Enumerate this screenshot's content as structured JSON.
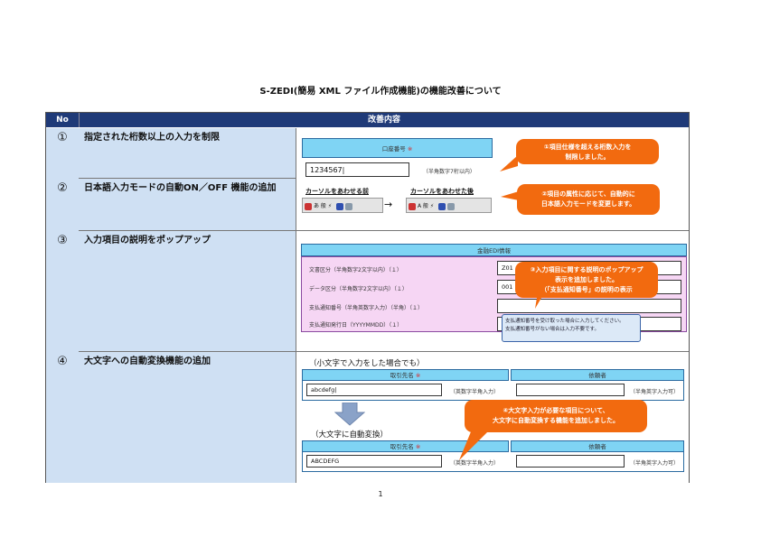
{
  "document": {
    "title": "S-ZEDI(簡易 XML ファイル作成機能)の機能改善について",
    "page_number": "1"
  },
  "table": {
    "col_no": "No",
    "col_content": "改善内容",
    "rows": [
      {
        "no": "①",
        "desc": "指定された桁数以上の入力を制限"
      },
      {
        "no": "②",
        "desc": "日本語入力モードの自動ON／OFF 機能の追加"
      },
      {
        "no": "③",
        "desc": "入力項目の説明をポップアップ"
      },
      {
        "no": "④",
        "desc": "大文字への自動変換機能の追加"
      }
    ]
  },
  "row1": {
    "field_label": "口座番号",
    "required_mark": "※",
    "input_value": "1234567|",
    "note": "（半角数字7桁以内）",
    "callout": "①項目仕様を超える桁数入力を\n制限しました。"
  },
  "row2": {
    "before_label": "カーソルをあわせる前",
    "after_label": "カーソルをあわせた後",
    "arrow": "→",
    "before_toolbar": "あ 般 ⚡",
    "after_toolbar": "A 般 ⚡",
    "callout": "②項目の属性に応じて、自動的に\n日本語入力モードを変更します。"
  },
  "row3": {
    "form_title": "金融EDI情報",
    "fields": [
      {
        "label": "文書区分（半角数字2文字以内）（１）",
        "value": "Z01"
      },
      {
        "label": "データ区分（半角数字2文字以内）（１）",
        "value": "001"
      },
      {
        "label": "支払通知番号（半角英数字入力）（半角）（１）",
        "value": ""
      },
      {
        "label": "支払通知発行日（YYYYMMDD）（１）",
        "value": ""
      }
    ],
    "tooltip": "支払通知番号を受け取った場合に入力してください。\n支払通知番号がない場合は入力不要です。",
    "callout": "③入力項目に関する説明のポップアップ\n表示を追加しました。\n（「支払通知番号」の説明の表示"
  },
  "row4": {
    "caption_lower": "（小文字で入力をした場合でも）",
    "caption_upper": "（大文字に自動変換）",
    "field_label": "取引先名",
    "required_mark": "※",
    "other_label": "依頼者",
    "lower_value": "abcdefg|",
    "upper_value": "ABCDEFG",
    "note_left": "（英数字半角入力）",
    "note_right": "（半角英字入力可）",
    "callout": "④大文字入力が必要な項目について、\n大文字に自動変換する機能を追加しました。"
  },
  "colors": {
    "header_bg": "#1f3a78",
    "desc_bg": "#cfe0f3",
    "callout_bg": "#f26a0f",
    "field_header_bg": "#7fd4f4",
    "form_bg": "#f6d6f4"
  }
}
